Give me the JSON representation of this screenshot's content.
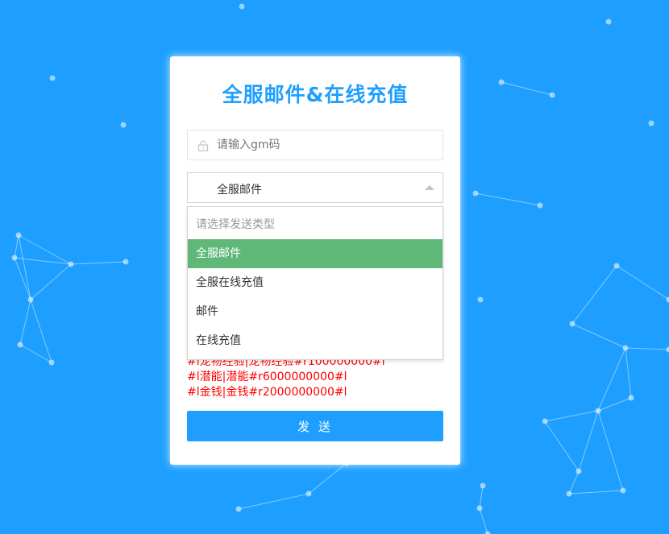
{
  "colors": {
    "background": "#1e9fff",
    "accent": "#1e9fff",
    "selected_option": "#5fb878",
    "hint_text": "#ff0000"
  },
  "title": "全服邮件&在线充值",
  "gm_input": {
    "placeholder": "请输入gm码",
    "value": "",
    "icon": "lock-icon"
  },
  "send_type_select": {
    "selected": "全服邮件",
    "options": [
      {
        "label": "请选择发送类型",
        "placeholder": true
      },
      {
        "label": "全服邮件",
        "selected": true
      },
      {
        "label": "全服在线充值"
      },
      {
        "label": "邮件"
      },
      {
        "label": "在线充值"
      }
    ]
  },
  "hint_lines": [
    "#l宠物经验|宠物经验#r100000000#l",
    "#l潜能|潜能#r6000000000#l",
    "#l金钱|金钱#r2000000000#l"
  ],
  "send_button": "发 送"
}
